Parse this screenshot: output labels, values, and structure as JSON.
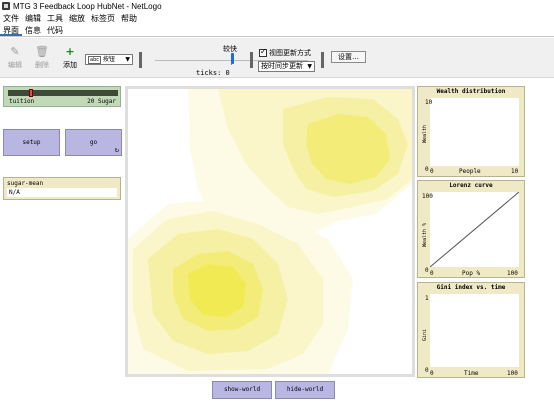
{
  "window": {
    "title": "MTG 3 Feedback Loop HubNet - NetLogo"
  },
  "menu": [
    "文件",
    "编辑",
    "工具",
    "缩放",
    "标签页",
    "帮助"
  ],
  "tabs": [
    "界面",
    "信息",
    "代码"
  ],
  "toolbar": {
    "edit_label": "编辑",
    "delete_label": "删除",
    "add_label": "添加",
    "widget_type": "按钮",
    "speed_label": "较快",
    "ticks_label": "ticks: 0",
    "view_updates_label": "视图更新方式",
    "update_mode": "按时间步更新",
    "settings_label": "设置…"
  },
  "slider": {
    "name": "tuition",
    "value": "20",
    "units": "Sugar",
    "fraction": 0.2
  },
  "buttons": {
    "setup": "setup",
    "go": "go",
    "show_world": "show-world",
    "hide_world": "hide-world"
  },
  "monitor": {
    "name": "sugar-mean",
    "value": "N/A"
  },
  "plots": [
    {
      "title": "Wealth distribution",
      "ylabel": "Wealth",
      "xlabel": "People",
      "ymin": "0",
      "ymax": "10",
      "xmin": "0",
      "xmax": "10"
    },
    {
      "title": "Lorenz curve",
      "ylabel": "Wealth %",
      "xlabel": "Pop %",
      "ymin": "0",
      "ymax": "100",
      "xmin": "0",
      "xmax": "100"
    },
    {
      "title": "Gini index vs. time",
      "ylabel": "Gini",
      "xlabel": "Time",
      "ymin": "0",
      "ymax": "1",
      "xmin": "0",
      "xmax": "100"
    }
  ],
  "colors": {
    "button_bg": "#b9b7e2",
    "slider_bg": "#c2d9b9",
    "monitor_bg": "#efeac5",
    "sugar_peak": "#f2ea52"
  }
}
